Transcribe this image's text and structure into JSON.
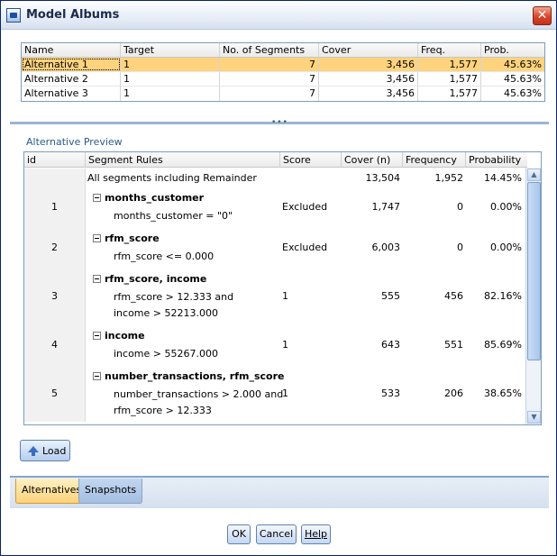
{
  "window": {
    "title": "Model Albums",
    "close_glyph": "✕"
  },
  "alternatives_table": {
    "headers": {
      "name": "Name",
      "target": "Target",
      "segments": "No. of Segments",
      "cover": "Cover",
      "freq": "Freq.",
      "prob": "Prob."
    },
    "rows": [
      {
        "name": "Alternative 1",
        "target": "1",
        "segments": "7",
        "cover": "3,456",
        "freq": "1,577",
        "prob": "45.63%",
        "selected": true
      },
      {
        "name": "Alternative 2",
        "target": "1",
        "segments": "7",
        "cover": "3,456",
        "freq": "1,577",
        "prob": "45.63%"
      },
      {
        "name": "Alternative 3",
        "target": "1",
        "segments": "7",
        "cover": "3,456",
        "freq": "1,577",
        "prob": "45.63%"
      }
    ]
  },
  "splitter_glyph": "•••",
  "preview": {
    "label": "Alternative Preview",
    "headers": {
      "id": "id",
      "rules": "Segment Rules",
      "score": "Score",
      "cover": "Cover (n)",
      "frequency": "Frequency",
      "probability": "Probability"
    },
    "summary_row": {
      "rules": "All segments including Remainder",
      "cover": "13,504",
      "frequency": "1,952",
      "probability": "14.45%"
    },
    "rows": [
      {
        "id": "1",
        "title": "months_customer",
        "lines": [
          "months_customer = \"0\""
        ],
        "score": "Excluded",
        "cover": "1,747",
        "frequency": "0",
        "probability": "0.00%"
      },
      {
        "id": "2",
        "title": "rfm_score",
        "lines": [
          "rfm_score <= 0.000"
        ],
        "score": "Excluded",
        "cover": "6,003",
        "frequency": "0",
        "probability": "0.00%"
      },
      {
        "id": "3",
        "title": "rfm_score, income",
        "lines": [
          "rfm_score > 12.333 and",
          "income > 52213.000"
        ],
        "score": "1",
        "cover": "555",
        "frequency": "456",
        "probability": "82.16%"
      },
      {
        "id": "4",
        "title": "income",
        "lines": [
          "income > 55267.000"
        ],
        "score": "1",
        "cover": "643",
        "frequency": "551",
        "probability": "85.69%"
      },
      {
        "id": "5",
        "title": "number_transactions, rfm_score",
        "lines": [
          "number_transactions > 2.000 and",
          "rfm_score > 12.333"
        ],
        "score": "1",
        "cover": "533",
        "frequency": "206",
        "probability": "38.65%"
      }
    ],
    "scroll_up_glyph": "▲",
    "scroll_down_glyph": "▼"
  },
  "load_button": {
    "label": "Load",
    "icon": "up-arrow-icon"
  },
  "tabs": [
    {
      "label": "Alternatives",
      "active": true
    },
    {
      "label": "Snapshots",
      "active": false
    }
  ],
  "buttons": {
    "ok": "OK",
    "cancel": "Cancel",
    "help": "Help"
  },
  "colors": {
    "selected_row": "#ffd37e",
    "active_tab": "#fcd27a",
    "accent": "#7fa7cf"
  }
}
